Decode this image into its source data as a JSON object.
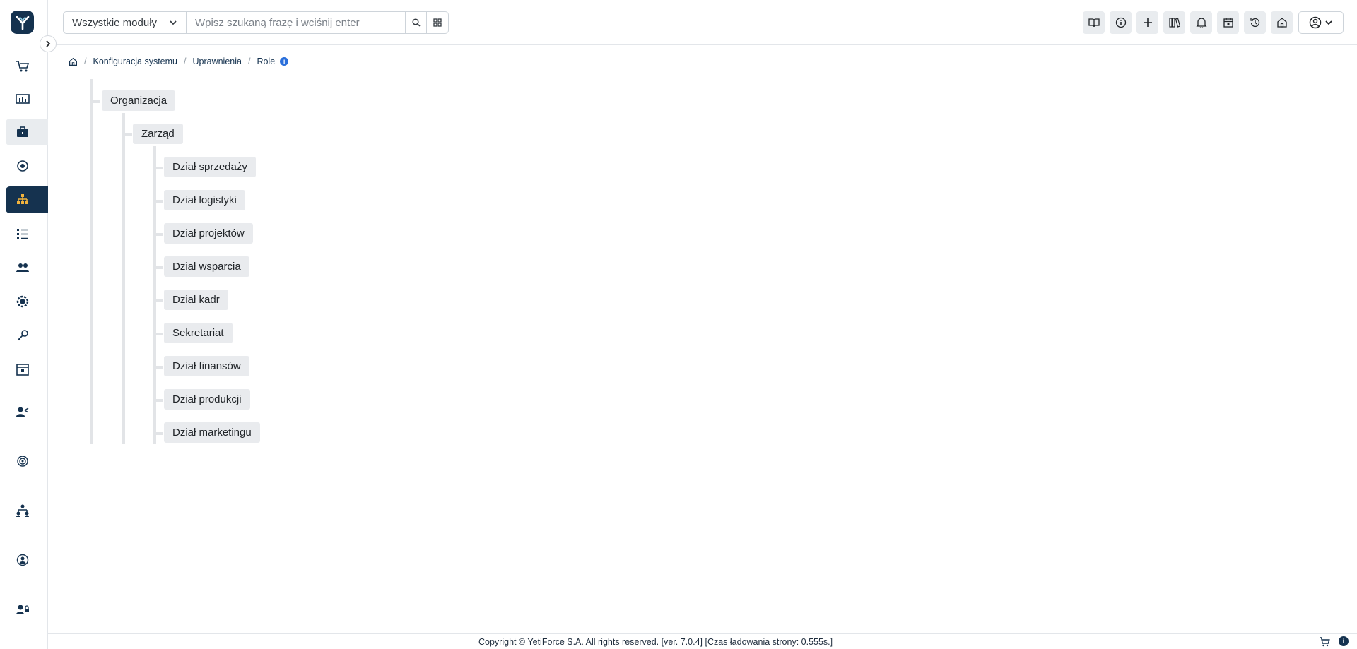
{
  "header": {
    "module_select_value": "Wszystkie moduły",
    "search_placeholder": "Wpisz szukaną frazę i wciśnij enter"
  },
  "breadcrumb": {
    "items": [
      "Konfiguracja systemu",
      "Uprawnienia",
      "Role"
    ]
  },
  "tree": {
    "root": "Organizacja",
    "level1": "Zarząd",
    "children": [
      "Dział sprzedaży",
      "Dział logistyki",
      "Dział projektów",
      "Dział wsparcia",
      "Dział kadr",
      "Sekretariat",
      "Dział finansów",
      "Dział produkcji",
      "Dział marketingu"
    ]
  },
  "footer": {
    "text": "Copyright © YetiForce S.A. All rights reserved. [ver. 7.0.4] [Czas ładowania strony: 0.555s.]"
  },
  "colors": {
    "brand": "#15324f",
    "accent": "#f2b33d",
    "info": "#2a6fdb"
  },
  "sidebar": {
    "icons": [
      "cart-icon",
      "dashboard-icon",
      "briefcase-icon",
      "support-icon",
      "org-chart-icon",
      "list-icon",
      "users-icon",
      "cog-cube-icon",
      "key-icon",
      "calendar-icon",
      "user-share-icon",
      "fingerprint-icon",
      "user-tree-icon",
      "user-sync-icon",
      "user-lock-icon"
    ]
  }
}
